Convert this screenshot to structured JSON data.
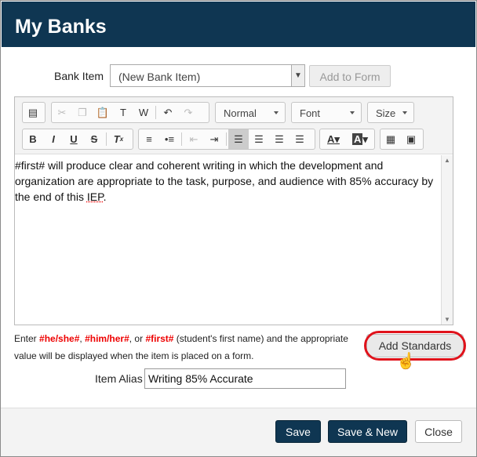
{
  "header": {
    "title": "My Banks"
  },
  "bank_item": {
    "label": "Bank Item",
    "value": "(New Bank Item)",
    "add_button": "Add to Form"
  },
  "toolbar": {
    "format": "Normal",
    "font": "Font",
    "size": "Size",
    "buttons": [
      "source",
      "cut",
      "copy",
      "paste",
      "paste-text",
      "paste-word",
      "undo",
      "redo",
      "bold",
      "italic",
      "underline",
      "strikethrough",
      "remove-format",
      "numbered-list",
      "bulleted-list",
      "outdent",
      "indent",
      "align-left",
      "align-center",
      "align-right",
      "justify",
      "text-color",
      "background-color",
      "table",
      "image"
    ],
    "active": "align-left"
  },
  "editor": {
    "text_before": "#first# will produce clear and coherent writing in which the development and organization are appropriate to the task, purpose, and audience with 85% accuracy by the end of this ",
    "text_flagged": "IEP",
    "text_after": "."
  },
  "help": {
    "t1": "Enter ",
    "p1": "#he/she#",
    "t2": ", ",
    "p2": "#him/her#",
    "t3": ", or ",
    "p3": "#first#",
    "t4": " (student's first name) and the appropriate value will be displayed when the item is placed on a form."
  },
  "standards_button": "Add Standards",
  "alias": {
    "label": "Item Alias",
    "value": "Writing 85% Accurate"
  },
  "footer": {
    "save": "Save",
    "save_new": "Save & New",
    "close": "Close"
  },
  "colors": {
    "header": "#0f3652",
    "primary_button": "#0f3652",
    "placeholder_text": "#e00000",
    "highlight_ring": "#e0121b"
  }
}
